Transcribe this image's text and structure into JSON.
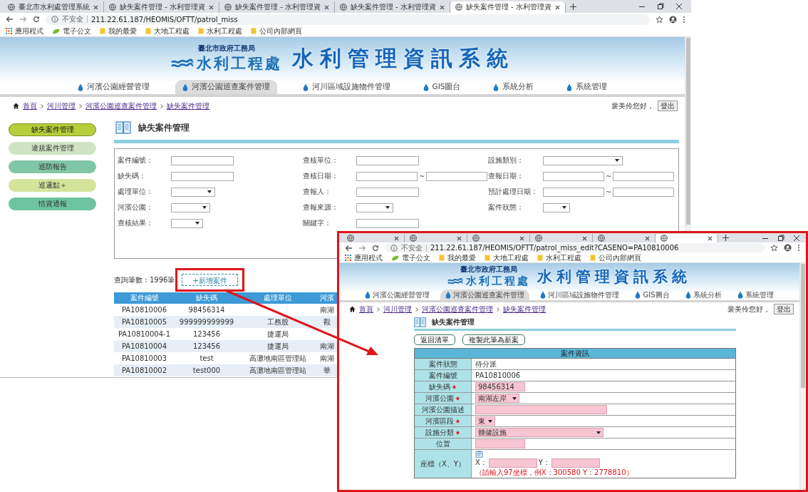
{
  "browser": {
    "tabs": [
      {
        "title": "臺北市水利處管理系統",
        "selected": false
      },
      {
        "title": "缺失案件管理 - 水利管理資",
        "selected": false
      },
      {
        "title": "缺失案件管理 - 水利管理資",
        "selected": false
      },
      {
        "title": "缺失案件管理 - 水利管理資",
        "selected": false
      },
      {
        "title": "缺失案件管理 - 水利管理資",
        "selected": true
      }
    ],
    "address": {
      "security": "不安全",
      "url": "211.22.61.187/HEOMIS/OFTT/patrol_miss"
    },
    "bookmarks": [
      {
        "label": "應用程式",
        "kind": "apps"
      },
      {
        "label": "電子公文",
        "kind": "page"
      },
      {
        "label": "我的最愛",
        "kind": "folder"
      },
      {
        "label": "大地工程處",
        "kind": "folder"
      },
      {
        "label": "水利工程處",
        "kind": "folder"
      },
      {
        "label": "公司內部網頁",
        "kind": "folder"
      }
    ]
  },
  "header": {
    "agency": "臺北市政府工務局",
    "office": "水利工程處",
    "system_title": "水利管理資訊系統"
  },
  "nav": [
    {
      "label": "河濱公園經營管理",
      "selected": false
    },
    {
      "label": "河濱公園巡查案件管理",
      "selected": true
    },
    {
      "label": "河川區域設施物件管理",
      "selected": false
    },
    {
      "label": "GIS圖台",
      "selected": false
    },
    {
      "label": "系統分析",
      "selected": false
    },
    {
      "label": "系統管理",
      "selected": false
    }
  ],
  "breadcrumb": [
    "首頁",
    "河川管理",
    "河濱公園巡查案件管理",
    "缺失案件管理"
  ],
  "user": {
    "greeting": "裴美伶您好，",
    "logout": "登出"
  },
  "sidebar": [
    {
      "label": "缺失案件管理",
      "selected": true,
      "color": "#b6cd3c"
    },
    {
      "label": "違規案件管理",
      "selected": false,
      "color": "#cfe4c5"
    },
    {
      "label": "巡防報告",
      "selected": false,
      "color": "#80c7a5"
    },
    {
      "label": "巡邏點＋",
      "selected": false,
      "color": "#d5e49b"
    },
    {
      "label": "情資通報",
      "selected": false,
      "color": "#6dc4a1"
    }
  ],
  "page_title": "缺失案件管理",
  "search_form": {
    "fields": [
      {
        "label": "案件編號：",
        "kind": "text"
      },
      {
        "label": "查核單位：",
        "kind": "text"
      },
      {
        "label": "設施類別：",
        "kind": "select"
      },
      {
        "label": "缺失碼：",
        "kind": "text"
      },
      {
        "label": "查核日期：",
        "kind": "range",
        "separator": "~"
      },
      {
        "label": "查報日期：",
        "kind": "range",
        "separator": "~"
      },
      {
        "label": "處理單位：",
        "kind": "select"
      },
      {
        "label": "查報人：",
        "kind": "text"
      },
      {
        "label": "預計處理日期：",
        "kind": "range",
        "separator": "~"
      },
      {
        "label": "河濱公園：",
        "kind": "select"
      },
      {
        "label": "查報來源：",
        "kind": "select"
      },
      {
        "label": "案件狀態：",
        "kind": "select"
      },
      {
        "label": "查核結果：",
        "kind": "select"
      },
      {
        "label": "關鍵字：",
        "kind": "text"
      }
    ]
  },
  "results": {
    "count": "查詢筆數：1996筆",
    "add_button": "+新增案件",
    "table": {
      "columns": [
        "案件編號",
        "缺失碼",
        "處理單位",
        "河濱"
      ],
      "rows": [
        [
          "PA10810006",
          "98456314",
          "",
          "南湖"
        ],
        [
          "PA10810005",
          "999999999999",
          "工務股",
          "觀"
        ],
        [
          "PA10810004-1",
          "123456",
          "捷運局",
          ""
        ],
        [
          "PA10810004",
          "123456",
          "捷運局",
          "南湖"
        ],
        [
          "PA10810003",
          "test",
          "高灘地南區管理站",
          "南湖"
        ],
        [
          "PA10810002",
          "test000",
          "高灘地南區管理站",
          "華"
        ]
      ]
    }
  },
  "inset": {
    "browser": {
      "tabs": [
        {
          "selected": false
        },
        {
          "selected": false
        },
        {
          "selected": false
        },
        {
          "selected": false
        },
        {
          "selected": false
        },
        {
          "selected": true
        }
      ],
      "address": {
        "security": "不安全",
        "url": "211.22.61.187/HEOMIS/OFTT/patrol_miss_edit?CASENO=PA10810006"
      },
      "bookmarks": [
        {
          "label": "應用程式",
          "kind": "apps"
        },
        {
          "label": "電子公文",
          "kind": "page"
        },
        {
          "label": "我的最愛",
          "kind": "folder"
        },
        {
          "label": "大地工程處",
          "kind": "folder"
        },
        {
          "label": "水利工程處",
          "kind": "folder"
        },
        {
          "label": "公司內部網頁",
          "kind": "folder"
        }
      ]
    },
    "header": {
      "agency": "臺北市政府工務局",
      "office": "水利工程處",
      "system_title": "水利管理資訊系統"
    },
    "nav": [
      {
        "label": "河濱公園經營管理",
        "selected": false
      },
      {
        "label": "河濱公園巡查案件管理",
        "selected": true
      },
      {
        "label": "河川區域設施物件管理",
        "selected": false
      },
      {
        "label": "GIS圖台",
        "selected": false
      },
      {
        "label": "系統分析",
        "selected": false
      },
      {
        "label": "系統管理",
        "selected": false
      }
    ],
    "breadcrumb": [
      "首頁",
      "河川管理",
      "河濱公園巡查案件管理",
      "缺失案件管理"
    ],
    "user": {
      "greeting": "裴美伶您好，",
      "logout": "登出"
    },
    "page_title": "缺失案件管理",
    "buttons": [
      "返回清單",
      "複製此筆為新案"
    ],
    "case_table": {
      "title": "案件資訊",
      "rows": [
        {
          "label": "案件狀態",
          "kind": "text",
          "required": false,
          "value": "待分派"
        },
        {
          "label": "案件編號",
          "kind": "text",
          "required": false,
          "value": "PA10810006"
        },
        {
          "label": "缺失碼",
          "kind": "input",
          "required": true,
          "value": "98456314"
        },
        {
          "label": "河濱公園",
          "kind": "select",
          "required": true,
          "value": "南湖左岸"
        },
        {
          "label": "河濱公園描述",
          "kind": "input",
          "required": false
        },
        {
          "label": "河濱區段",
          "kind": "select",
          "required": true,
          "value": "東"
        },
        {
          "label": "設施分類",
          "kind": "select",
          "required": true,
          "value": "體健設施"
        },
        {
          "label": "位置",
          "kind": "input",
          "required": false
        },
        {
          "label": "座標（X、Y）",
          "kind": "coords",
          "required": false,
          "x_label": "X：",
          "y_label": "Y：",
          "hint": "（請輸入97坐標，例X：300580 Y：2778810）"
        }
      ]
    }
  }
}
